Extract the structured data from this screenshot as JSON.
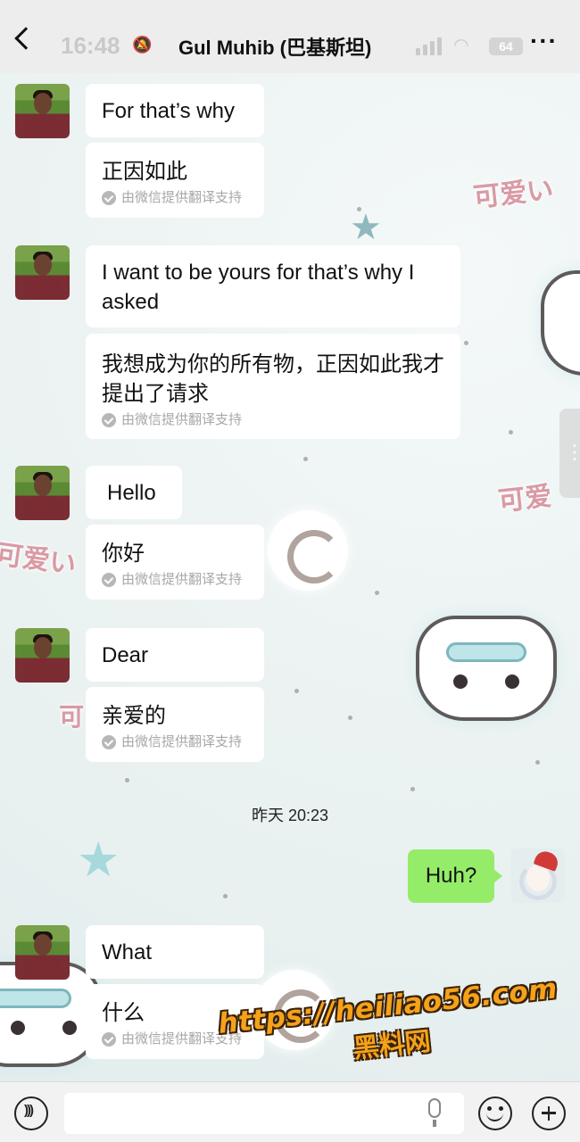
{
  "status_bar": {
    "time": "16:48",
    "battery": "64"
  },
  "header": {
    "title": "Gul Muhib (巴基斯坦)"
  },
  "background": {
    "sticker_texts": [
      "可爱い",
      "可爱",
      "可爱い",
      "可"
    ]
  },
  "translation_note": "由微信提供翻译支持",
  "messages": [
    {
      "original": "For that’s why",
      "translated": "正因如此"
    },
    {
      "original": "I want to be yours for that’s why I asked",
      "translated": "我想成为你的所有物，正因如此我才提出了请求"
    },
    {
      "original": "Hello",
      "translated": "你好"
    },
    {
      "original": "Dear",
      "translated": "亲爱的"
    },
    {
      "original": "What",
      "translated": "什么"
    }
  ],
  "timestamp": "昨天 20:23",
  "my_message": "Huh?",
  "watermark": {
    "url": "https://heiliao56.com",
    "name": "黑料网"
  },
  "colors": {
    "my_bubble": "#95ec69",
    "header_bg": "#ededed",
    "watermark": "#f5a21b"
  }
}
